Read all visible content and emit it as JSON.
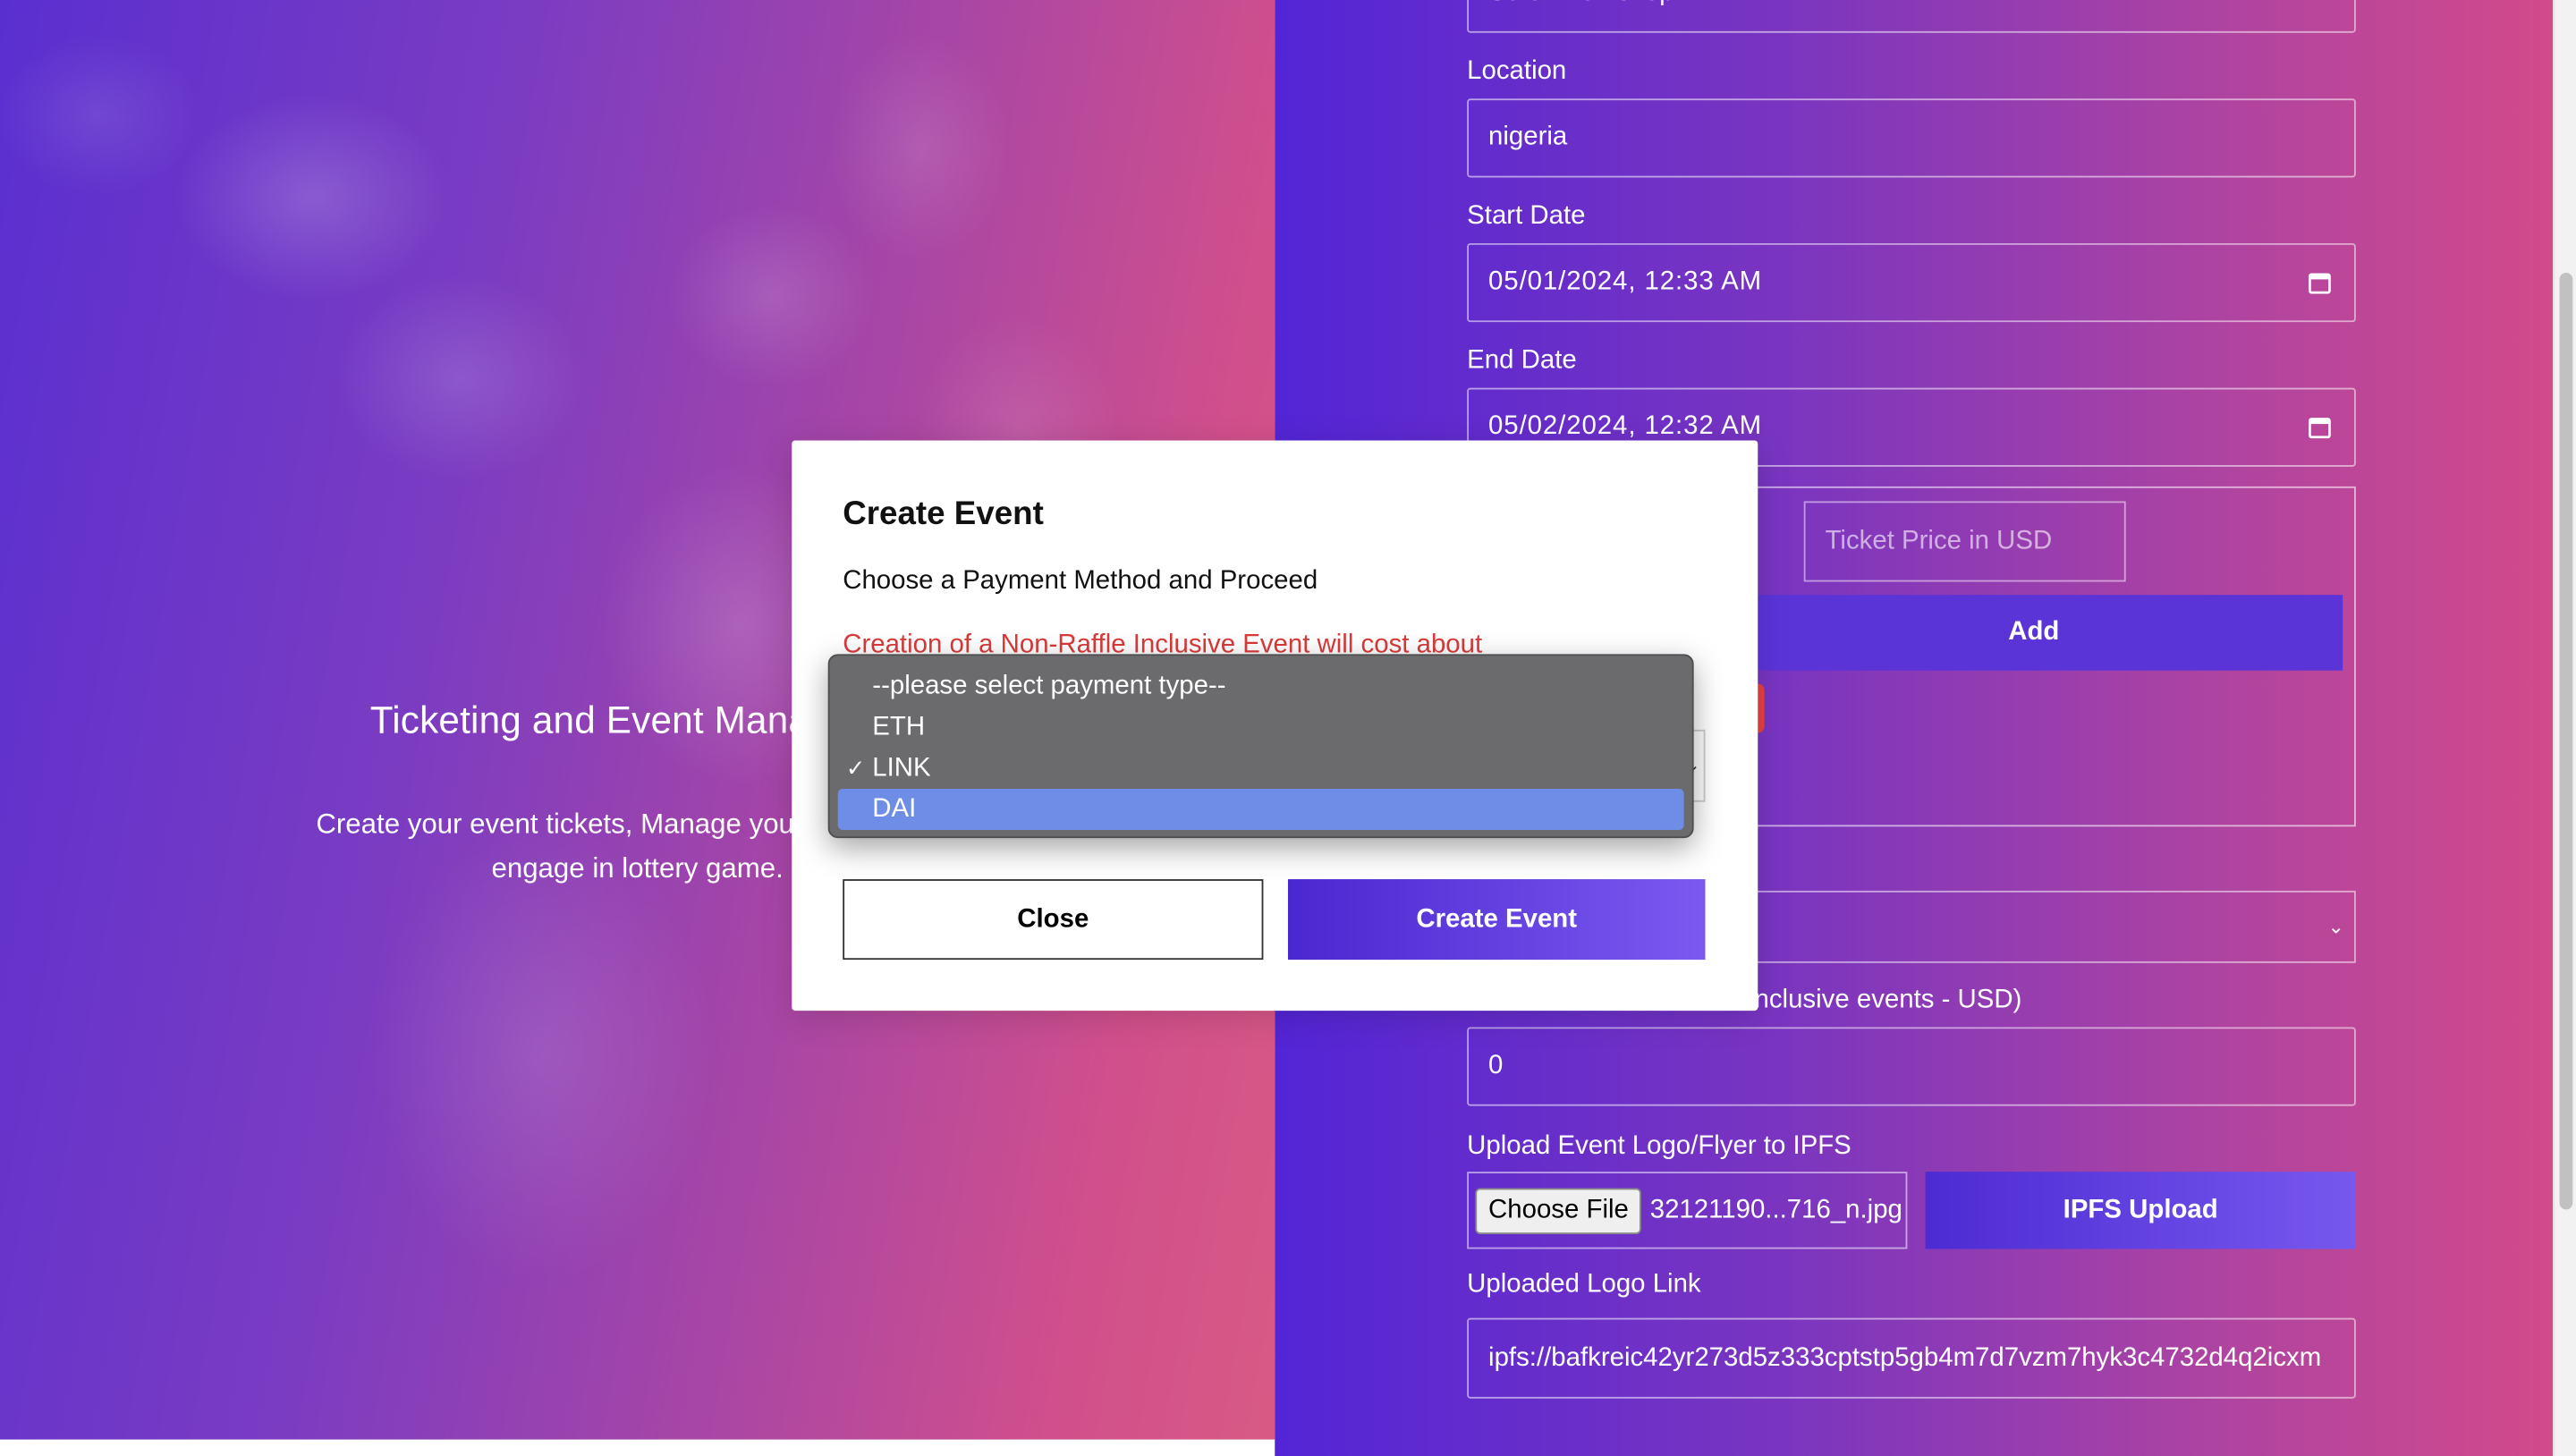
{
  "hero": {
    "title": "Ticketing and Event Manageme",
    "subtitle_line1": "Create your event tickets, Manage your ticketing typ",
    "subtitle_line2": "engage in lottery game."
  },
  "form": {
    "title_value_partial": "Scroll workshop",
    "location_label": "Location",
    "location_value": "nigeria",
    "start_date_label": "Start Date",
    "start_date_value": "05/01/2024, 12:33 AM",
    "end_date_label": "End Date",
    "end_date_value": "05/02/2024, 12:32 AM",
    "ticket_price_placeholder": "Ticket Price in USD",
    "add_button": "Add",
    "raffle_price_label": "affle inclusive events - USD)",
    "raffle_price_value": "0",
    "upload_label": "Upload Event Logo/Flyer to IPFS",
    "choose_file": "Choose File",
    "file_name": "32121190...716_n.jpg",
    "ipfs_button": "IPFS Upload",
    "logo_link_label": "Uploaded Logo Link",
    "logo_link_value": "ipfs://bafkreic42yr273d5z333cptstp5gb4m7d7vzm7hyk3c4732d4q2icxm"
  },
  "modal": {
    "title": "Create Event",
    "description": "Choose a Payment Method and Proceed",
    "cost_text": "Creation of a Non-Raffle Inclusive Event will cost about",
    "close_button": "Close",
    "create_button": "Create Event"
  },
  "dropdown": {
    "options": [
      "--please select payment type--",
      "ETH",
      "LINK",
      "DAI"
    ],
    "checked": "LINK",
    "highlighted": "DAI"
  },
  "colors": {
    "accent": "#5b34d8",
    "cost_warning": "#d93a3a",
    "highlight": "#6d8de6"
  }
}
